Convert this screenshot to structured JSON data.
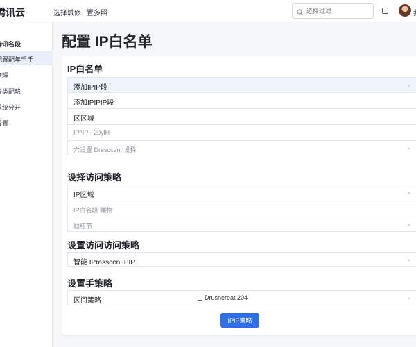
{
  "header": {
    "brand": "腾讯云",
    "nav": [
      "选择城修",
      "置多照"
    ],
    "search_placeholder": "选择过滤",
    "user_name": "我"
  },
  "sidebar": {
    "items": [
      {
        "label": "腾讯名段",
        "type": "header"
      },
      {
        "label": "配置配年手手",
        "type": "active"
      },
      {
        "label": "管理",
        "type": "normal"
      },
      {
        "label": "分类配略",
        "type": "normal"
      },
      {
        "label": "系统分开",
        "type": "normal"
      },
      {
        "label": "设置",
        "type": "normal"
      }
    ]
  },
  "page": {
    "title": "配置 IP白名单"
  },
  "sections": [
    {
      "title": "IP白名单",
      "rows": [
        {
          "label": "添加IPIP段",
          "style": "highlight",
          "chevron": true
        },
        {
          "label": "添加IPIPIP段",
          "style": "normal",
          "chevron": false
        },
        {
          "label": "区区域",
          "style": "normal",
          "chevron": false
        },
        {
          "label": "IP^IP - 20ylH",
          "style": "muted",
          "chevron": false
        },
        {
          "label": "穴设置 Dresccent 设择",
          "style": "muted",
          "chevron": true
        }
      ]
    },
    {
      "title": "设择访问策略",
      "rows": [
        {
          "label": "IP区域",
          "style": "normal",
          "chevron": true
        },
        {
          "label": "IP白名段 踹物",
          "style": "muted",
          "chevron": false
        },
        {
          "label": "题练节",
          "style": "muted",
          "chevron": true
        }
      ]
    },
    {
      "title": "设置访问访问策略",
      "rows": [
        {
          "label": "智能 IPrasscen IPIP",
          "style": "normal",
          "chevron": true
        }
      ]
    },
    {
      "title": "设置手策略",
      "rows": [
        {
          "label": "区问策略",
          "style": "normal",
          "chevron": true,
          "checkbox_label": "Drusnereat 204"
        }
      ]
    }
  ],
  "submit_label": "IPIP策略",
  "colors": {
    "accent": "#2f6fe6",
    "highlight_row": "#eef3fc",
    "background": "#f5f6f8"
  }
}
